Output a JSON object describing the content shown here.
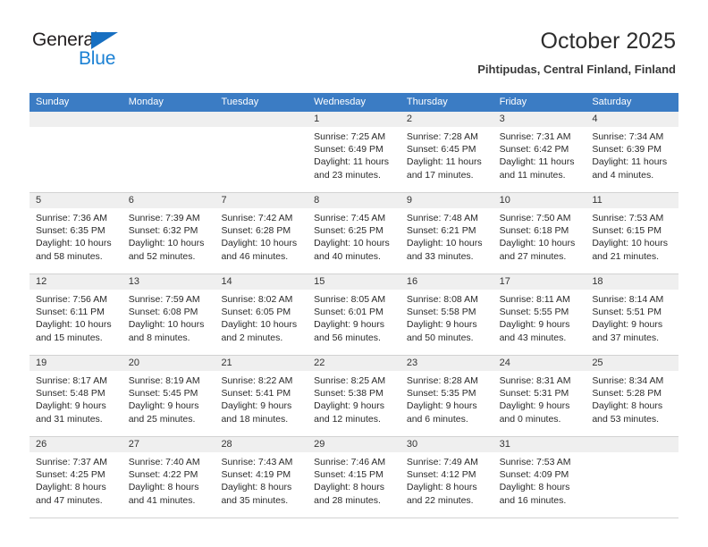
{
  "brand": {
    "name_part1": "General",
    "name_part2": "Blue",
    "triangle_icon": "triangle-icon",
    "colors": {
      "dark": "#231f20",
      "blue": "#1b81d4",
      "triangle": "#176fc1"
    }
  },
  "header": {
    "title": "October 2025",
    "subtitle": "Pihtipudas, Central Finland, Finland"
  },
  "calendar": {
    "header_bg": "#3b7cc4",
    "daynum_bg": "#efefef",
    "weekdays": [
      "Sunday",
      "Monday",
      "Tuesday",
      "Wednesday",
      "Thursday",
      "Friday",
      "Saturday"
    ],
    "weeks": [
      [
        {
          "day": "",
          "sunrise": "",
          "sunset": "",
          "daylight1": "",
          "daylight2": ""
        },
        {
          "day": "",
          "sunrise": "",
          "sunset": "",
          "daylight1": "",
          "daylight2": ""
        },
        {
          "day": "",
          "sunrise": "",
          "sunset": "",
          "daylight1": "",
          "daylight2": ""
        },
        {
          "day": "1",
          "sunrise": "Sunrise: 7:25 AM",
          "sunset": "Sunset: 6:49 PM",
          "daylight1": "Daylight: 11 hours",
          "daylight2": "and 23 minutes."
        },
        {
          "day": "2",
          "sunrise": "Sunrise: 7:28 AM",
          "sunset": "Sunset: 6:45 PM",
          "daylight1": "Daylight: 11 hours",
          "daylight2": "and 17 minutes."
        },
        {
          "day": "3",
          "sunrise": "Sunrise: 7:31 AM",
          "sunset": "Sunset: 6:42 PM",
          "daylight1": "Daylight: 11 hours",
          "daylight2": "and 11 minutes."
        },
        {
          "day": "4",
          "sunrise": "Sunrise: 7:34 AM",
          "sunset": "Sunset: 6:39 PM",
          "daylight1": "Daylight: 11 hours",
          "daylight2": "and 4 minutes."
        }
      ],
      [
        {
          "day": "5",
          "sunrise": "Sunrise: 7:36 AM",
          "sunset": "Sunset: 6:35 PM",
          "daylight1": "Daylight: 10 hours",
          "daylight2": "and 58 minutes."
        },
        {
          "day": "6",
          "sunrise": "Sunrise: 7:39 AM",
          "sunset": "Sunset: 6:32 PM",
          "daylight1": "Daylight: 10 hours",
          "daylight2": "and 52 minutes."
        },
        {
          "day": "7",
          "sunrise": "Sunrise: 7:42 AM",
          "sunset": "Sunset: 6:28 PM",
          "daylight1": "Daylight: 10 hours",
          "daylight2": "and 46 minutes."
        },
        {
          "day": "8",
          "sunrise": "Sunrise: 7:45 AM",
          "sunset": "Sunset: 6:25 PM",
          "daylight1": "Daylight: 10 hours",
          "daylight2": "and 40 minutes."
        },
        {
          "day": "9",
          "sunrise": "Sunrise: 7:48 AM",
          "sunset": "Sunset: 6:21 PM",
          "daylight1": "Daylight: 10 hours",
          "daylight2": "and 33 minutes."
        },
        {
          "day": "10",
          "sunrise": "Sunrise: 7:50 AM",
          "sunset": "Sunset: 6:18 PM",
          "daylight1": "Daylight: 10 hours",
          "daylight2": "and 27 minutes."
        },
        {
          "day": "11",
          "sunrise": "Sunrise: 7:53 AM",
          "sunset": "Sunset: 6:15 PM",
          "daylight1": "Daylight: 10 hours",
          "daylight2": "and 21 minutes."
        }
      ],
      [
        {
          "day": "12",
          "sunrise": "Sunrise: 7:56 AM",
          "sunset": "Sunset: 6:11 PM",
          "daylight1": "Daylight: 10 hours",
          "daylight2": "and 15 minutes."
        },
        {
          "day": "13",
          "sunrise": "Sunrise: 7:59 AM",
          "sunset": "Sunset: 6:08 PM",
          "daylight1": "Daylight: 10 hours",
          "daylight2": "and 8 minutes."
        },
        {
          "day": "14",
          "sunrise": "Sunrise: 8:02 AM",
          "sunset": "Sunset: 6:05 PM",
          "daylight1": "Daylight: 10 hours",
          "daylight2": "and 2 minutes."
        },
        {
          "day": "15",
          "sunrise": "Sunrise: 8:05 AM",
          "sunset": "Sunset: 6:01 PM",
          "daylight1": "Daylight: 9 hours",
          "daylight2": "and 56 minutes."
        },
        {
          "day": "16",
          "sunrise": "Sunrise: 8:08 AM",
          "sunset": "Sunset: 5:58 PM",
          "daylight1": "Daylight: 9 hours",
          "daylight2": "and 50 minutes."
        },
        {
          "day": "17",
          "sunrise": "Sunrise: 8:11 AM",
          "sunset": "Sunset: 5:55 PM",
          "daylight1": "Daylight: 9 hours",
          "daylight2": "and 43 minutes."
        },
        {
          "day": "18",
          "sunrise": "Sunrise: 8:14 AM",
          "sunset": "Sunset: 5:51 PM",
          "daylight1": "Daylight: 9 hours",
          "daylight2": "and 37 minutes."
        }
      ],
      [
        {
          "day": "19",
          "sunrise": "Sunrise: 8:17 AM",
          "sunset": "Sunset: 5:48 PM",
          "daylight1": "Daylight: 9 hours",
          "daylight2": "and 31 minutes."
        },
        {
          "day": "20",
          "sunrise": "Sunrise: 8:19 AM",
          "sunset": "Sunset: 5:45 PM",
          "daylight1": "Daylight: 9 hours",
          "daylight2": "and 25 minutes."
        },
        {
          "day": "21",
          "sunrise": "Sunrise: 8:22 AM",
          "sunset": "Sunset: 5:41 PM",
          "daylight1": "Daylight: 9 hours",
          "daylight2": "and 18 minutes."
        },
        {
          "day": "22",
          "sunrise": "Sunrise: 8:25 AM",
          "sunset": "Sunset: 5:38 PM",
          "daylight1": "Daylight: 9 hours",
          "daylight2": "and 12 minutes."
        },
        {
          "day": "23",
          "sunrise": "Sunrise: 8:28 AM",
          "sunset": "Sunset: 5:35 PM",
          "daylight1": "Daylight: 9 hours",
          "daylight2": "and 6 minutes."
        },
        {
          "day": "24",
          "sunrise": "Sunrise: 8:31 AM",
          "sunset": "Sunset: 5:31 PM",
          "daylight1": "Daylight: 9 hours",
          "daylight2": "and 0 minutes."
        },
        {
          "day": "25",
          "sunrise": "Sunrise: 8:34 AM",
          "sunset": "Sunset: 5:28 PM",
          "daylight1": "Daylight: 8 hours",
          "daylight2": "and 53 minutes."
        }
      ],
      [
        {
          "day": "26",
          "sunrise": "Sunrise: 7:37 AM",
          "sunset": "Sunset: 4:25 PM",
          "daylight1": "Daylight: 8 hours",
          "daylight2": "and 47 minutes."
        },
        {
          "day": "27",
          "sunrise": "Sunrise: 7:40 AM",
          "sunset": "Sunset: 4:22 PM",
          "daylight1": "Daylight: 8 hours",
          "daylight2": "and 41 minutes."
        },
        {
          "day": "28",
          "sunrise": "Sunrise: 7:43 AM",
          "sunset": "Sunset: 4:19 PM",
          "daylight1": "Daylight: 8 hours",
          "daylight2": "and 35 minutes."
        },
        {
          "day": "29",
          "sunrise": "Sunrise: 7:46 AM",
          "sunset": "Sunset: 4:15 PM",
          "daylight1": "Daylight: 8 hours",
          "daylight2": "and 28 minutes."
        },
        {
          "day": "30",
          "sunrise": "Sunrise: 7:49 AM",
          "sunset": "Sunset: 4:12 PM",
          "daylight1": "Daylight: 8 hours",
          "daylight2": "and 22 minutes."
        },
        {
          "day": "31",
          "sunrise": "Sunrise: 7:53 AM",
          "sunset": "Sunset: 4:09 PM",
          "daylight1": "Daylight: 8 hours",
          "daylight2": "and 16 minutes."
        },
        {
          "day": "",
          "sunrise": "",
          "sunset": "",
          "daylight1": "",
          "daylight2": ""
        }
      ]
    ]
  }
}
